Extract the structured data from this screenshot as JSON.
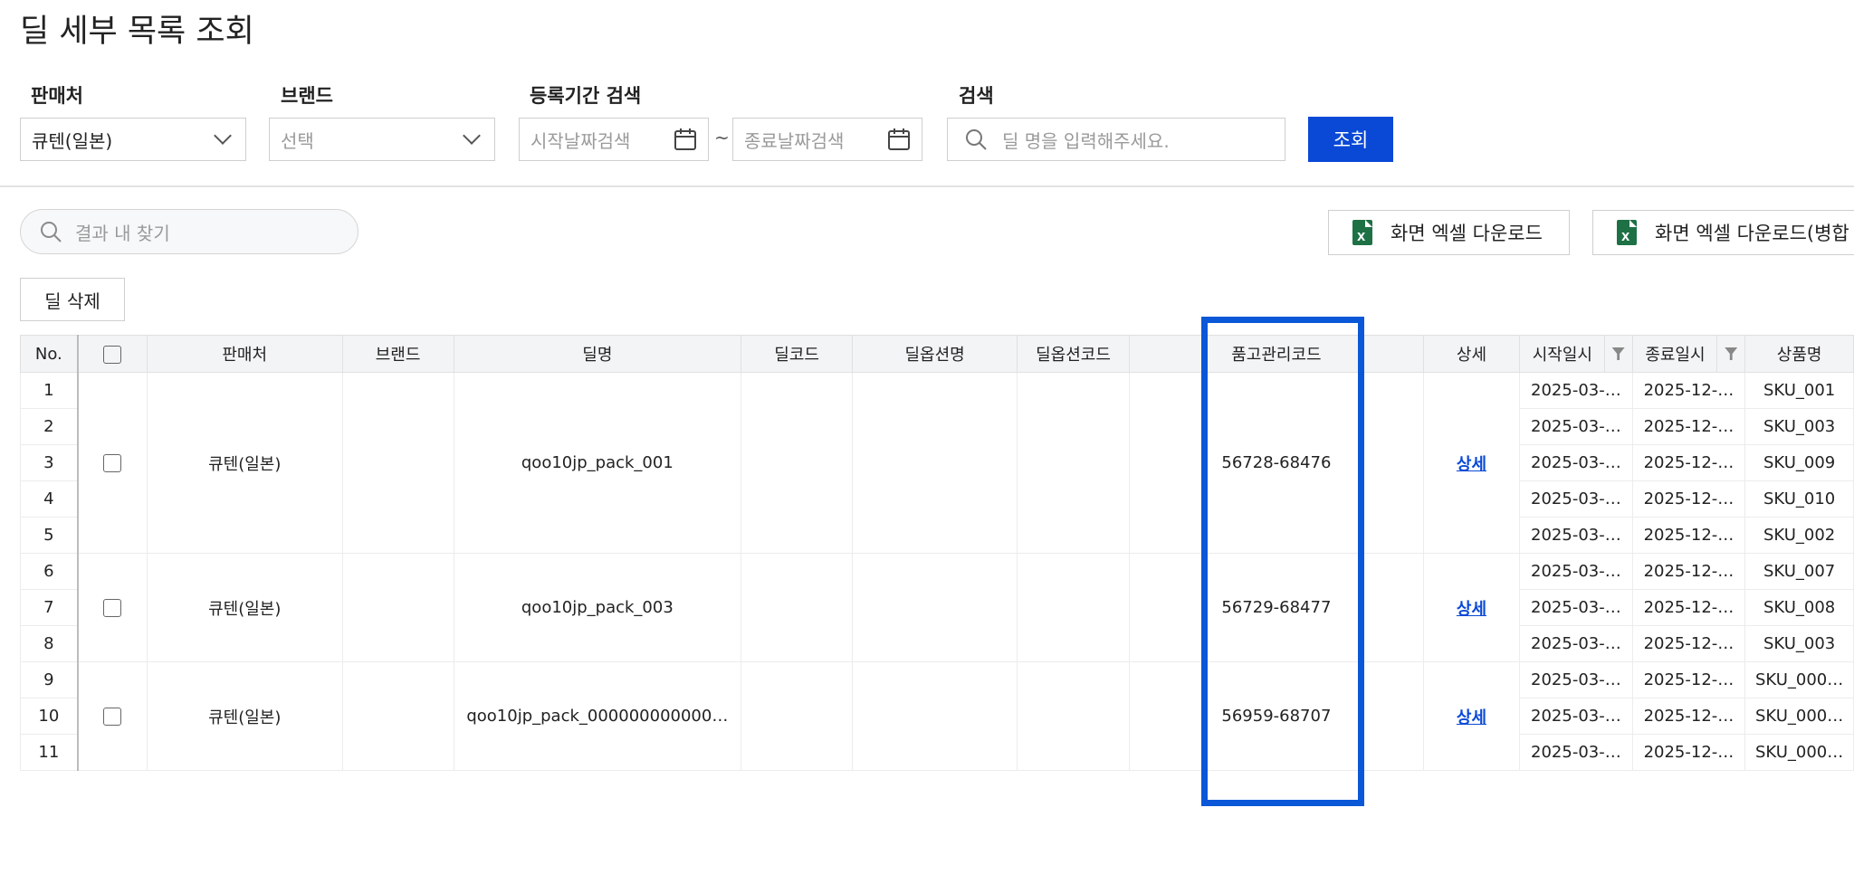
{
  "page": {
    "title": "딜 세부 목록 조회"
  },
  "filters": {
    "seller_label": "판매처",
    "seller_value": "큐텐(일본)",
    "brand_label": "브랜드",
    "brand_value": "선택",
    "period_label": "등록기간 검색",
    "start_placeholder": "시작날짜검색",
    "tilde": "~",
    "end_placeholder": "종료날짜검색",
    "search_label": "검색",
    "search_placeholder": "딜 명을 입력해주세요.",
    "search_button": "조회"
  },
  "toolbar": {
    "result_search_placeholder": "결과 내 찾기",
    "excel_download": "화면 엑셀 다운로드",
    "excel_download_merged": "화면 엑셀 다운로드(병합",
    "delete_deal": "딜 삭제"
  },
  "icons": {
    "excel": "X"
  },
  "table": {
    "headers": {
      "no": "No.",
      "seller": "판매처",
      "brand": "브랜드",
      "deal_name": "딜명",
      "deal_code": "딜코드",
      "option_name": "딜옵션명",
      "option_code": "딜옵션코드",
      "stock_code": "품고관리코드",
      "detail": "상세",
      "start": "시작일시",
      "end": "종료일시",
      "product": "상품명"
    },
    "groups": [
      {
        "seller": "큐텐(일본)",
        "deal_name": "qoo10jp_pack_001",
        "stock_code": "56728-68476",
        "detail": "상세"
      },
      {
        "seller": "큐텐(일본)",
        "deal_name": "qoo10jp_pack_003",
        "stock_code": "56729-68477",
        "detail": "상세"
      },
      {
        "seller": "큐텐(일본)",
        "deal_name": "qoo10jp_pack_000000000000…",
        "stock_code": "56959-68707",
        "detail": "상세"
      }
    ],
    "rows": [
      {
        "no": "1",
        "start": "2025-03-…",
        "end": "2025-12-…",
        "product": "SKU_001"
      },
      {
        "no": "2",
        "start": "2025-03-…",
        "end": "2025-12-…",
        "product": "SKU_003"
      },
      {
        "no": "3",
        "start": "2025-03-…",
        "end": "2025-12-…",
        "product": "SKU_009"
      },
      {
        "no": "4",
        "start": "2025-03-…",
        "end": "2025-12-…",
        "product": "SKU_010"
      },
      {
        "no": "5",
        "start": "2025-03-…",
        "end": "2025-12-…",
        "product": "SKU_002"
      },
      {
        "no": "6",
        "start": "2025-03-…",
        "end": "2025-12-…",
        "product": "SKU_007"
      },
      {
        "no": "7",
        "start": "2025-03-…",
        "end": "2025-12-…",
        "product": "SKU_008"
      },
      {
        "no": "8",
        "start": "2025-03-…",
        "end": "2025-12-…",
        "product": "SKU_003"
      },
      {
        "no": "9",
        "start": "2025-03-…",
        "end": "2025-12-…",
        "product": "SKU_000…"
      },
      {
        "no": "10",
        "start": "2025-03-…",
        "end": "2025-12-…",
        "product": "SKU_000…"
      },
      {
        "no": "11",
        "start": "2025-03-…",
        "end": "2025-12-…",
        "product": "SKU_000…"
      }
    ]
  },
  "colors": {
    "accent": "#0a49d6",
    "highlight": "#0a57d8",
    "excel": "#1e7145"
  }
}
